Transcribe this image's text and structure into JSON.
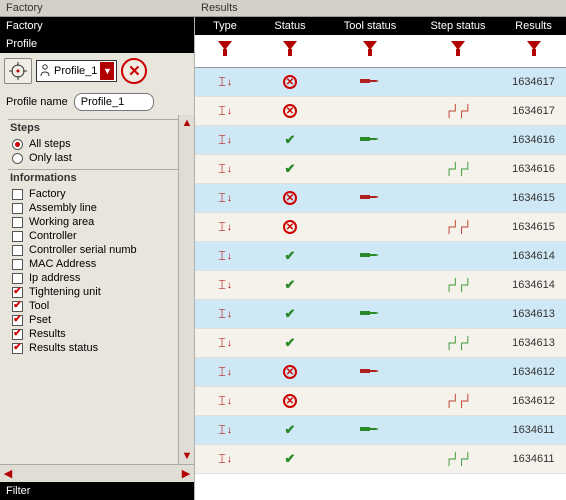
{
  "top": {
    "left": "Factory",
    "right": "Results"
  },
  "left": {
    "factory_hdr": "Factory",
    "profile_hdr": "Profile",
    "profile_dropdown": "Profile_1",
    "profile_name_label": "Profile name",
    "profile_name_value": "Profile_1",
    "steps": {
      "title": "Steps",
      "all": "All steps",
      "only_last": "Only last",
      "selected": "all"
    },
    "info": {
      "title": "Informations",
      "items": [
        {
          "label": "Factory",
          "checked": false
        },
        {
          "label": "Assembly line",
          "checked": false
        },
        {
          "label": "Working area",
          "checked": false
        },
        {
          "label": "Controller",
          "checked": false
        },
        {
          "label": "Controller serial numb",
          "checked": false
        },
        {
          "label": "MAC Address",
          "checked": false
        },
        {
          "label": "Ip address",
          "checked": false
        },
        {
          "label": "Tightening unit",
          "checked": true
        },
        {
          "label": "Tool",
          "checked": true
        },
        {
          "label": "Pset",
          "checked": true
        },
        {
          "label": "Results",
          "checked": true
        },
        {
          "label": "Results status",
          "checked": true
        }
      ]
    }
  },
  "filter_label": "Filter",
  "results": {
    "headers": {
      "type": "Type",
      "status": "Status",
      "tool": "Tool status",
      "step": "Step status",
      "results": "Results"
    },
    "rows": [
      {
        "status": "fail",
        "tool": "red",
        "step": "",
        "result": "1634617"
      },
      {
        "status": "fail",
        "tool": "",
        "step": "red",
        "result": "1634617"
      },
      {
        "status": "ok",
        "tool": "green",
        "step": "",
        "result": "1634616"
      },
      {
        "status": "ok",
        "tool": "",
        "step": "green",
        "result": "1634616"
      },
      {
        "status": "fail",
        "tool": "red",
        "step": "",
        "result": "1634615"
      },
      {
        "status": "fail",
        "tool": "",
        "step": "red",
        "result": "1634615"
      },
      {
        "status": "ok",
        "tool": "green",
        "step": "",
        "result": "1634614"
      },
      {
        "status": "ok",
        "tool": "",
        "step": "green",
        "result": "1634614"
      },
      {
        "status": "ok",
        "tool": "green",
        "step": "",
        "result": "1634613"
      },
      {
        "status": "ok",
        "tool": "",
        "step": "green",
        "result": "1634613"
      },
      {
        "status": "fail",
        "tool": "red",
        "step": "",
        "result": "1634612"
      },
      {
        "status": "fail",
        "tool": "",
        "step": "red",
        "result": "1634612"
      },
      {
        "status": "ok",
        "tool": "green",
        "step": "",
        "result": "1634611"
      },
      {
        "status": "ok",
        "tool": "",
        "step": "green",
        "result": "1634611"
      }
    ]
  }
}
